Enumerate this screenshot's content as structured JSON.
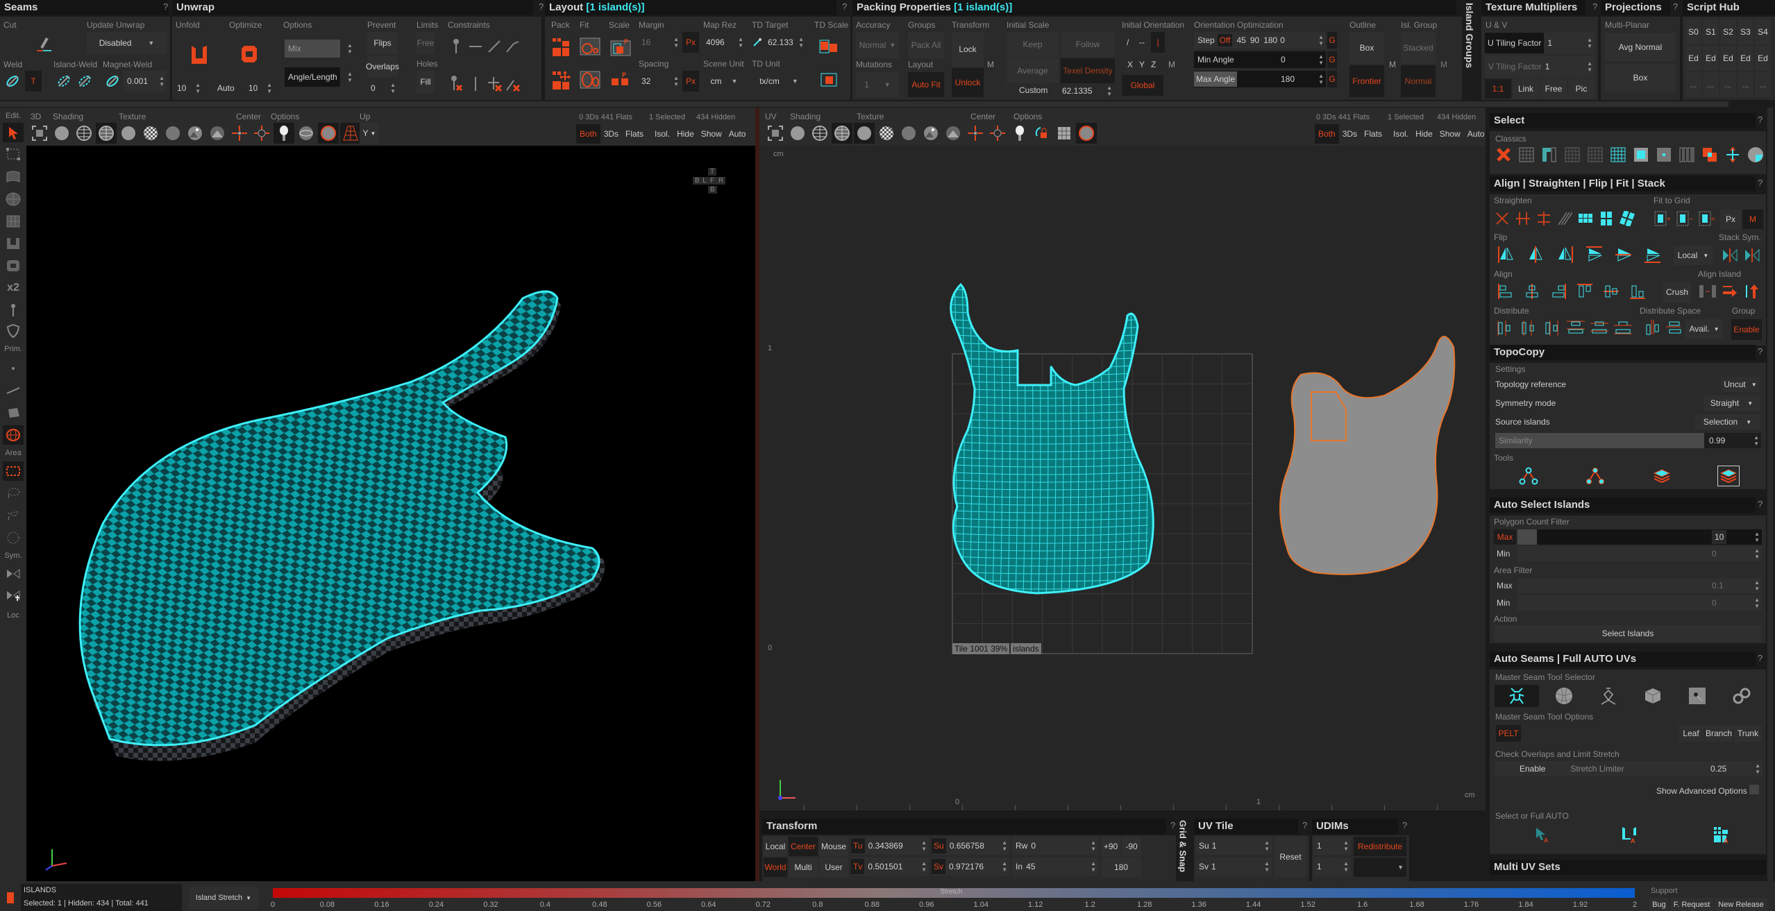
{
  "panels": {
    "seams": {
      "title": "Seams",
      "help": "?",
      "cut_label": "Cut",
      "update_unwrap_label": "Update Unwrap",
      "update_unwrap_value": "Disabled",
      "weld_label": "Weld",
      "weld_t": "T",
      "island_weld_label": "Island-Weld",
      "magnet_weld_label": "Magnet-Weld",
      "magnet_weld_value": "0.001"
    },
    "unwrap": {
      "title": "Unwrap",
      "help": "?",
      "unfold_label": "Unfold",
      "optimize_label": "Optimize",
      "unfold_iter": "10",
      "optimize_mode": "Auto",
      "optimize_iter": "10",
      "options_label": "Options",
      "options_mode": "Mix",
      "options_metric": "Angle/Length",
      "prevent_label": "Prevent",
      "flips": "Flips",
      "overlaps": "Overlaps",
      "overlaps_value": "0",
      "limits_label": "Limits",
      "limits_value": "Free",
      "holes_label": "Holes",
      "holes_value": "Fill",
      "constraints_label": "Constraints"
    },
    "layout": {
      "title": "Layout",
      "title_suffix": "[1 island(s)]",
      "help": "?",
      "pack_label": "Pack",
      "fit_label": "Fit",
      "scale_label": "Scale",
      "margin_label": "Margin",
      "margin_value": "16",
      "margin_unit": "Px",
      "spacing_label": "Spacing",
      "spacing_value": "32",
      "spacing_unit": "Px",
      "map_rez_label": "Map Rez",
      "map_rez_value": "4096",
      "scene_unit_label": "Scene Unit",
      "scene_unit_value": "cm",
      "td_target_label": "TD Target",
      "td_target_value": "62.133",
      "td_unit_label": "TD Unit",
      "td_unit_value": "tx/cm",
      "td_scale_label": "TD Scale"
    },
    "packing": {
      "title": "Packing Properties",
      "title_suffix": "[1 island(s)]",
      "help": "?",
      "accuracy_label": "Accuracy",
      "accuracy_value": "Normal",
      "mutations_label": "Mutations",
      "mutations_value": "1",
      "groups_label": "Groups",
      "groups_value": "Pack All",
      "layout_label": "Layout",
      "layout_value": "Auto Fit",
      "transform_label": "Transform",
      "lock": "Lock",
      "unlock": "Unlock",
      "m": "M",
      "initial_scale_label": "Initial Scale",
      "keep": "Keep",
      "follow": "Follow",
      "average": "Average",
      "texel_density": "Texel Density",
      "custom": "Custom",
      "custom_value": "62.1335",
      "initial_orientation_label": "Initial Orientation",
      "orient_a": "/",
      "orient_b": "--",
      "orient_c": "|",
      "x": "X",
      "y": "Y",
      "z": "Z",
      "global": "Global",
      "orientation_opt_label": "Orientation Optimization",
      "step": "Step",
      "step_off": "Off",
      "step_45": "45",
      "step_90": "90",
      "step_180": "180",
      "step_value": "0",
      "min_angle": "Min Angle",
      "min_angle_value": "0",
      "max_angle": "Max Angle",
      "max_angle_value": "180",
      "g": "G",
      "outline_label": "Outline",
      "outline_box": "Box",
      "outline_frontier": "Frontier",
      "isl_group_label": "Isl. Group",
      "isl_stacked": "Stacked",
      "isl_normal": "Normal"
    },
    "island_groups": {
      "title": "Island Groups"
    },
    "texture_multipliers": {
      "title": "Texture Multipliers",
      "help": "?",
      "uv_label": "U & V",
      "u_tiling": "U Tiling Factor",
      "u_value": "1",
      "v_tiling": "V Tiling Factor",
      "v_value": "1",
      "ratio": "1:1",
      "link": "Link",
      "free": "Free",
      "pic": "Pic"
    },
    "projections": {
      "title": "Projections",
      "help": "?",
      "multi_planar": "Multi-Planar",
      "avg_normal": "Avg Normal",
      "box": "Box"
    },
    "script_hub": {
      "title": "Script Hub",
      "row1": [
        "S0",
        "S1",
        "S2",
        "S3",
        "S4"
      ],
      "row2": [
        "Ed",
        "Ed",
        "Ed",
        "Ed",
        "Ed"
      ],
      "row3": [
        "...",
        "...",
        "...",
        "...",
        "..."
      ]
    }
  },
  "viewport3d": {
    "toolbar": {
      "edit": "Edit.",
      "mode": "3D",
      "shading": "Shading",
      "texture": "Texture",
      "center": "Center",
      "options": "Options",
      "up": "Up",
      "up_value": "Y"
    },
    "stats": {
      "counts": "0 3Ds 441 Flats",
      "selected": "1 Selected",
      "hidden": "434 Hidden"
    },
    "filters": [
      "Both",
      "3Ds",
      "Flats",
      "Isol.",
      "Hide",
      "Show",
      "Auto"
    ],
    "view_cube": {
      "top": "T",
      "back": "B",
      "left": "L",
      "front": "F",
      "right": "R",
      "bottom": "B"
    }
  },
  "viewport_uv": {
    "toolbar": {
      "mode": "UV",
      "shading": "Shading",
      "texture": "Texture",
      "center": "Center",
      "options": "Options"
    },
    "stats": {
      "counts": "0 3Ds 441 Flats",
      "selected": "1 Selected",
      "hidden": "434 Hidden"
    },
    "filters": [
      "Both",
      "3Ds",
      "Flats",
      "Isol.",
      "Hide",
      "Show",
      "Auto"
    ],
    "unit": "cm",
    "axis_v1": "1",
    "axis_v0": "0",
    "axis_u0": "0",
    "axis_u1": "1",
    "tile_label": "Tile 1001 39%",
    "islands_label": "islands"
  },
  "left_toolbar": {
    "edit": "Edit.",
    "prim": "Prim.",
    "area": "Area",
    "sym": "Sym.",
    "loc": "Loc",
    "x2": "x2"
  },
  "transform": {
    "title": "Transform",
    "help": "?",
    "local": "Local",
    "world": "World",
    "center": "Center",
    "multi": "Multi",
    "mouse": "Mouse",
    "user": "User",
    "tu_label": "Tu",
    "tu": "0.343869",
    "tv_label": "Tv",
    "tv": "0.501501",
    "su_label": "Su",
    "su": "0.656758",
    "sv_label": "Sv",
    "sv": "0.972176",
    "rw_label": "Rw",
    "rw": "0",
    "in_label": "In",
    "in": "45",
    "p90": "+90",
    "m90": "-90",
    "r180": "180"
  },
  "grid_snap": {
    "title": "Grid & Snap"
  },
  "uv_tile": {
    "title": "UV Tile",
    "help": "?",
    "su_label": "Su",
    "su": "1",
    "sv_label": "Sv",
    "sv": "1",
    "reset": "Reset"
  },
  "udims": {
    "title": "UDIMs",
    "help": "?",
    "v1": "1",
    "v2": "1",
    "redistribute": "Redistribute"
  },
  "right_panel": {
    "select": {
      "title": "Select",
      "help": "?",
      "classics": "Classics"
    },
    "align": {
      "title": "Align | Straighten | Flip | Fit | Stack",
      "help": "?",
      "straighten": "Straighten",
      "fit_to_grid": "Fit to Grid",
      "px": "Px",
      "m": "M",
      "flip": "Flip",
      "flip_space": "Local",
      "stack_sym": "Stack Sym.",
      "align": "Align",
      "crush": "Crush",
      "align_island": "Align Island",
      "distribute": "Distribute",
      "distribute_space": "Distribute Space",
      "avail": "Avail.",
      "group": "Group",
      "enable": "Enable"
    },
    "topocopy": {
      "title": "TopoCopy",
      "help": "?",
      "settings": "Settings",
      "topology_reference": "Topology reference",
      "topology_value": "Uncut",
      "symmetry_mode": "Symmetry mode",
      "symmetry_value": "Straight",
      "source_islands": "Source islands",
      "source_value": "Selection",
      "similarity": "Similarity",
      "similarity_value": "0.99",
      "tools": "Tools"
    },
    "auto_select": {
      "title": "Auto Select Islands",
      "help": "?",
      "polygon_count_filter": "Polygon Count Filter",
      "max": "Max",
      "max_value": "10",
      "min": "Min",
      "min_value": "0",
      "area_filter": "Area Filter",
      "area_max": "Max",
      "area_max_value": "0.1",
      "area_min": "Min",
      "area_min_value": "0",
      "action": "Action",
      "select_islands": "Select Islands"
    },
    "auto_seams": {
      "title": "Auto Seams | Full AUTO UVs",
      "help": "?",
      "master_selector": "Master Seam Tool Selector",
      "master_options": "Master Seam Tool Options",
      "pelt": "PELT",
      "leaf": "Leaf",
      "branch": "Branch",
      "trunk": "Trunk",
      "check_overlaps": "Check Overlaps and Limit Stretch",
      "enable": "Enable",
      "stretch_limiter": "Stretch Limiter",
      "stretch_value": "0.25",
      "show_advanced": "Show Advanced Options",
      "select_full_auto": "Select or Full AUTO"
    },
    "multi_uv": {
      "title": "Multi UV Sets"
    }
  },
  "status_bar": {
    "islands_title": "ISLANDS",
    "islands_info": "Selected: 1 | Hidden: 434 | Total: 441",
    "mode": "Island Stretch",
    "stretch_label": "Stretch",
    "ticks": [
      "0",
      "0.08",
      "0.16",
      "0.24",
      "0.32",
      "0.4",
      "0.48",
      "0.56",
      "0.64",
      "0.72",
      "0.8",
      "0.88",
      "0.96",
      "1.04",
      "1.12",
      "1.2",
      "1.28",
      "1.36",
      "1.44",
      "1.52",
      "1.6",
      "1.68",
      "1.76",
      "1.84",
      "1.92",
      "2"
    ],
    "support": "Support",
    "bug": "Bug",
    "feature_request": "F. Request",
    "new_release": "New Release"
  },
  "colors": {
    "accent_orange": "#e8461c",
    "accent_cyan": "#3ee6f0",
    "panel_bg": "#2a2a2a",
    "header_bg": "#141414"
  }
}
